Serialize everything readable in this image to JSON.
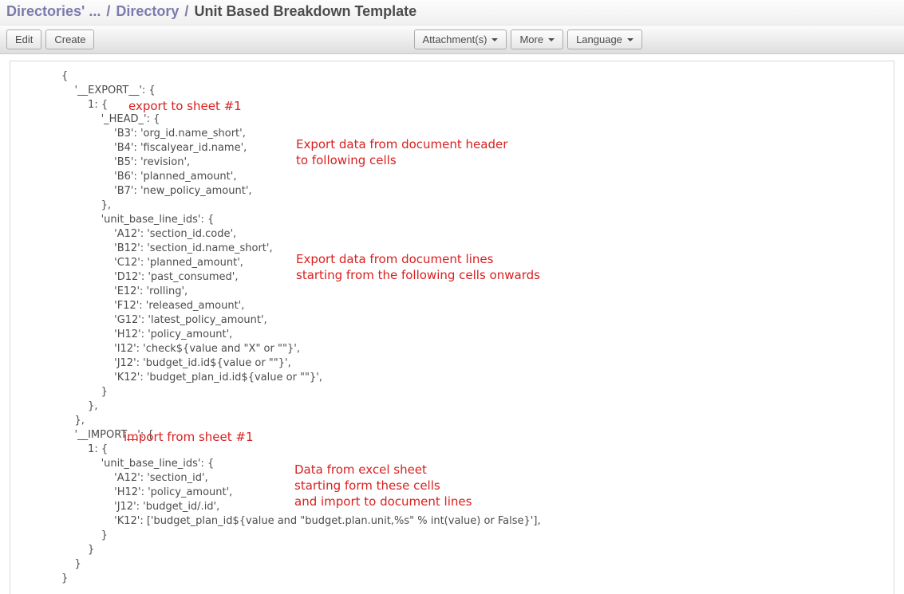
{
  "breadcrumb": {
    "root": "Directories' ...",
    "mid": "Directory",
    "current": "Unit Based Breakdown Template"
  },
  "toolbar": {
    "edit": "Edit",
    "create": "Create",
    "attachments": "Attachment(s)",
    "more": "More",
    "language": "Language"
  },
  "code": "{\n    '__EXPORT__': {\n        1: {\n            '_HEAD_': {\n                'B3': 'org_id.name_short',\n                'B4': 'fiscalyear_id.name',\n                'B5': 'revision',\n                'B6': 'planned_amount',\n                'B7': 'new_policy_amount',\n            },\n            'unit_base_line_ids': {\n                'A12': 'section_id.code',\n                'B12': 'section_id.name_short',\n                'C12': 'planned_amount',\n                'D12': 'past_consumed',\n                'E12': 'rolling',\n                'F12': 'released_amount',\n                'G12': 'latest_policy_amount',\n                'H12': 'policy_amount',\n                'I12': 'check${value and \"X\" or \"\"}',\n                'J12': 'budget_id.id${value or \"\"}',\n                'K12': 'budget_plan_id.id${value or \"\"}',\n            }\n        },\n    },\n    '__IMPORT__': {\n        1: {\n            'unit_base_line_ids': {\n                'A12': 'section_id',\n                'H12': 'policy_amount',\n                'J12': 'budget_id/.id',\n                'K12': ['budget_plan_id${value and \"budget.plan.unit,%s\" % int(value) or False}'],\n            }\n        }\n    }\n}",
  "annotations": {
    "a1": "export to sheet #1",
    "a2": "Export data from document header\nto following cells",
    "a3": "Export data from document lines\nstarting from the following cells onwards",
    "a4": "import from sheet #1",
    "a5": "Data from excel sheet\nstarting form these cells\nand import to document lines"
  }
}
